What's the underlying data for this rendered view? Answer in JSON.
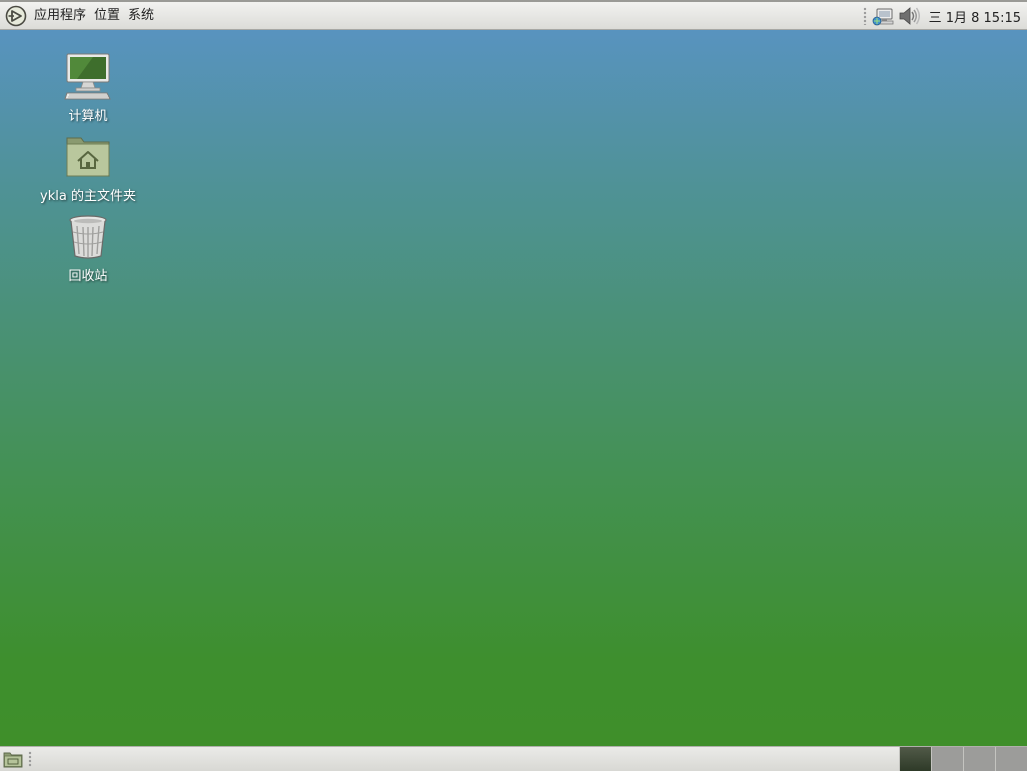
{
  "top_panel": {
    "menus": [
      {
        "label": "应用程序"
      },
      {
        "label": "位置"
      },
      {
        "label": "系统"
      }
    ],
    "tray_icons": [
      "network-icon",
      "volume-icon"
    ],
    "clock": "三 1月  8 15:15"
  },
  "desktop": {
    "icons": [
      {
        "label": "计算机",
        "icon": "computer-icon"
      },
      {
        "label": "ykla 的主文件夹",
        "icon": "home-folder-icon"
      },
      {
        "label": "回收站",
        "icon": "trash-icon"
      }
    ]
  },
  "bottom_panel": {
    "workspace_count": 4,
    "active_workspace": 1
  },
  "colors": {
    "desktop_top": "#5893bf",
    "desktop_bottom": "#3f8f2a",
    "panel": "#e6e6e3"
  }
}
